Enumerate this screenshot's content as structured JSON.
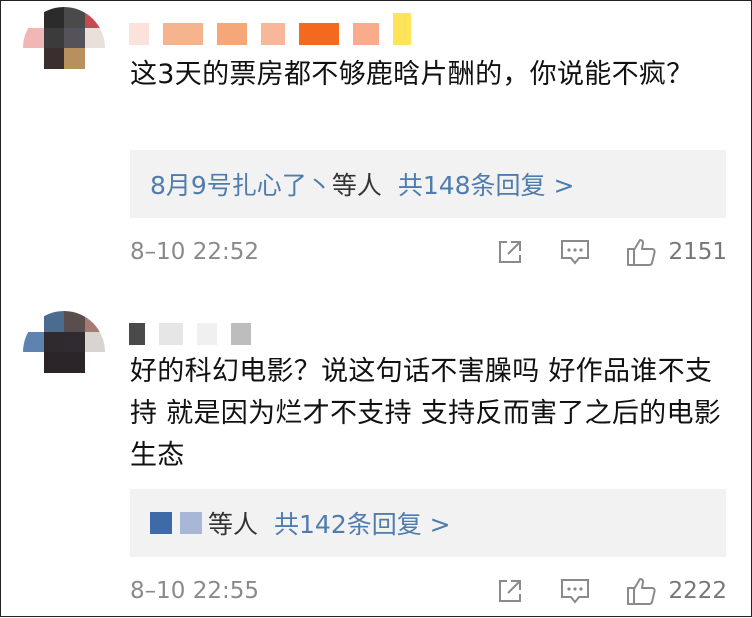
{
  "comments": [
    {
      "text": "这3天的票房都不够鹿晗片酬的，你说能不疯？",
      "reply_preview_user": "8月9号扎心了丶",
      "reply_sep": "等人",
      "reply_count_label": "共148条回复 >",
      "time": "8–10 22:52",
      "likes": "2151",
      "avatar_colors": [
        "#ffffff",
        "#2b2b2b",
        "#4a4a4a",
        "#c44b4f",
        "#f0b7b4",
        "#3b3b3b",
        "#55525a",
        "#e9e0db",
        "#ffffff",
        "#3b2e2e",
        "#b89060",
        "#ffffff",
        "#ffffff",
        "#ffffff",
        "#ffffff",
        "#ffffff"
      ],
      "name_colors": [
        "#fbe3dc",
        "#f6b48e",
        "#f5a77a",
        "#f7b89a",
        "#f36a1f",
        "#f9ac8c",
        "#ffe45a"
      ]
    },
    {
      "text": "好的科幻电影？说这句话不害臊吗 好作品谁不支持  就是因为烂才不支持 支持反而害了之后的电影生态",
      "reply_preview_user": "",
      "reply_sep": "等人",
      "reply_count_label": "共142条回复 >",
      "time": "8–10 22:55",
      "likes": "2222",
      "avatar_colors": [
        "#ffffff",
        "#4b6b8f",
        "#5a4d4d",
        "#a67a72",
        "#5d84b0",
        "#2e2a2e",
        "#302b30",
        "#d9d4d0",
        "#ffffff",
        "#2b2428",
        "#2b2428",
        "#ffffff",
        "#ffffff",
        "#ffffff",
        "#ffffff",
        "#ffffff"
      ],
      "name_colors": [
        "#4a4a4a",
        "#e6e6e6",
        "#f0f0f0",
        "#bdbdbd"
      ],
      "reply_avatar_colors": [
        "#3f6aa8",
        "#a9b7d6"
      ]
    }
  ],
  "icons": {
    "share": "share-icon",
    "comment": "comment-icon",
    "like": "thumbs-up-icon"
  }
}
